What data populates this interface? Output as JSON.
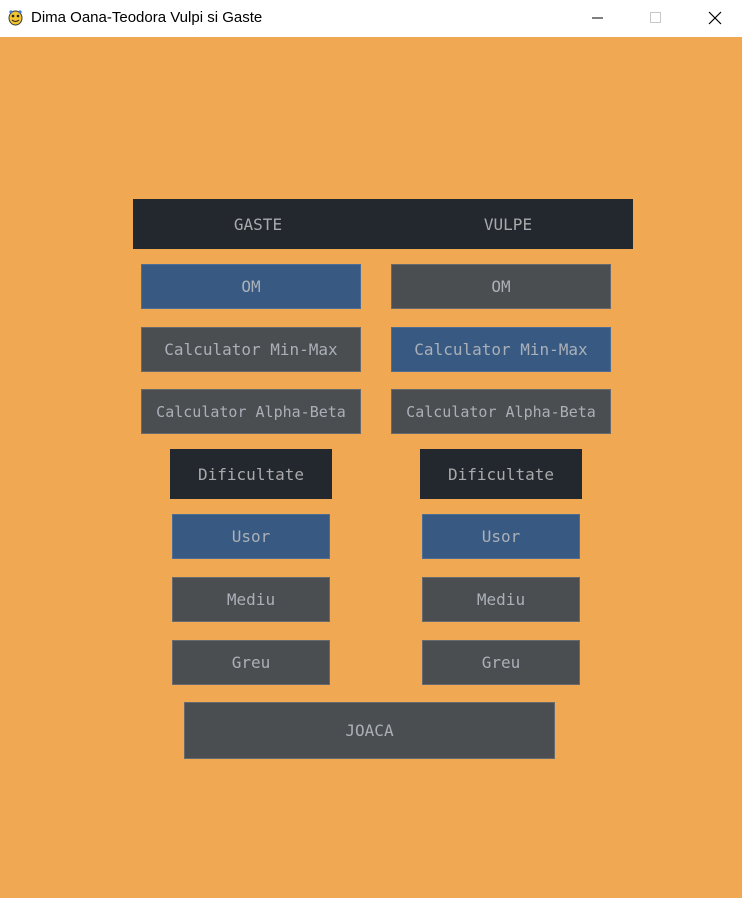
{
  "window": {
    "title": "Dima Oana-Teodora Vulpi si Gaste",
    "minimize_glyph": "—",
    "maximize_glyph": "□",
    "close_glyph": "✕",
    "icon": "pygame-snake-icon"
  },
  "colors": {
    "background": "#f0a852",
    "dark": "#23272e",
    "selected": "#385a82",
    "unselected": "#4b4e51",
    "text": "#a9aaac"
  },
  "header": {
    "left": "GASTE",
    "right": "VULPE"
  },
  "gaste": {
    "players": [
      {
        "label": "OM",
        "selected": true
      },
      {
        "label": "Calculator Min-Max",
        "selected": false
      },
      {
        "label": "Calculator Alpha-Beta",
        "selected": false
      }
    ],
    "difficulty_label": "Dificultate",
    "difficulty": [
      {
        "label": "Usor",
        "selected": true
      },
      {
        "label": "Mediu",
        "selected": false
      },
      {
        "label": "Greu",
        "selected": false
      }
    ]
  },
  "vulpe": {
    "players": [
      {
        "label": "OM",
        "selected": false
      },
      {
        "label": "Calculator Min-Max",
        "selected": true
      },
      {
        "label": "Calculator Alpha-Beta",
        "selected": false
      }
    ],
    "difficulty_label": "Dificultate",
    "difficulty": [
      {
        "label": "Usor",
        "selected": true
      },
      {
        "label": "Mediu",
        "selected": false
      },
      {
        "label": "Greu",
        "selected": false
      }
    ]
  },
  "play_button": "JOACA"
}
